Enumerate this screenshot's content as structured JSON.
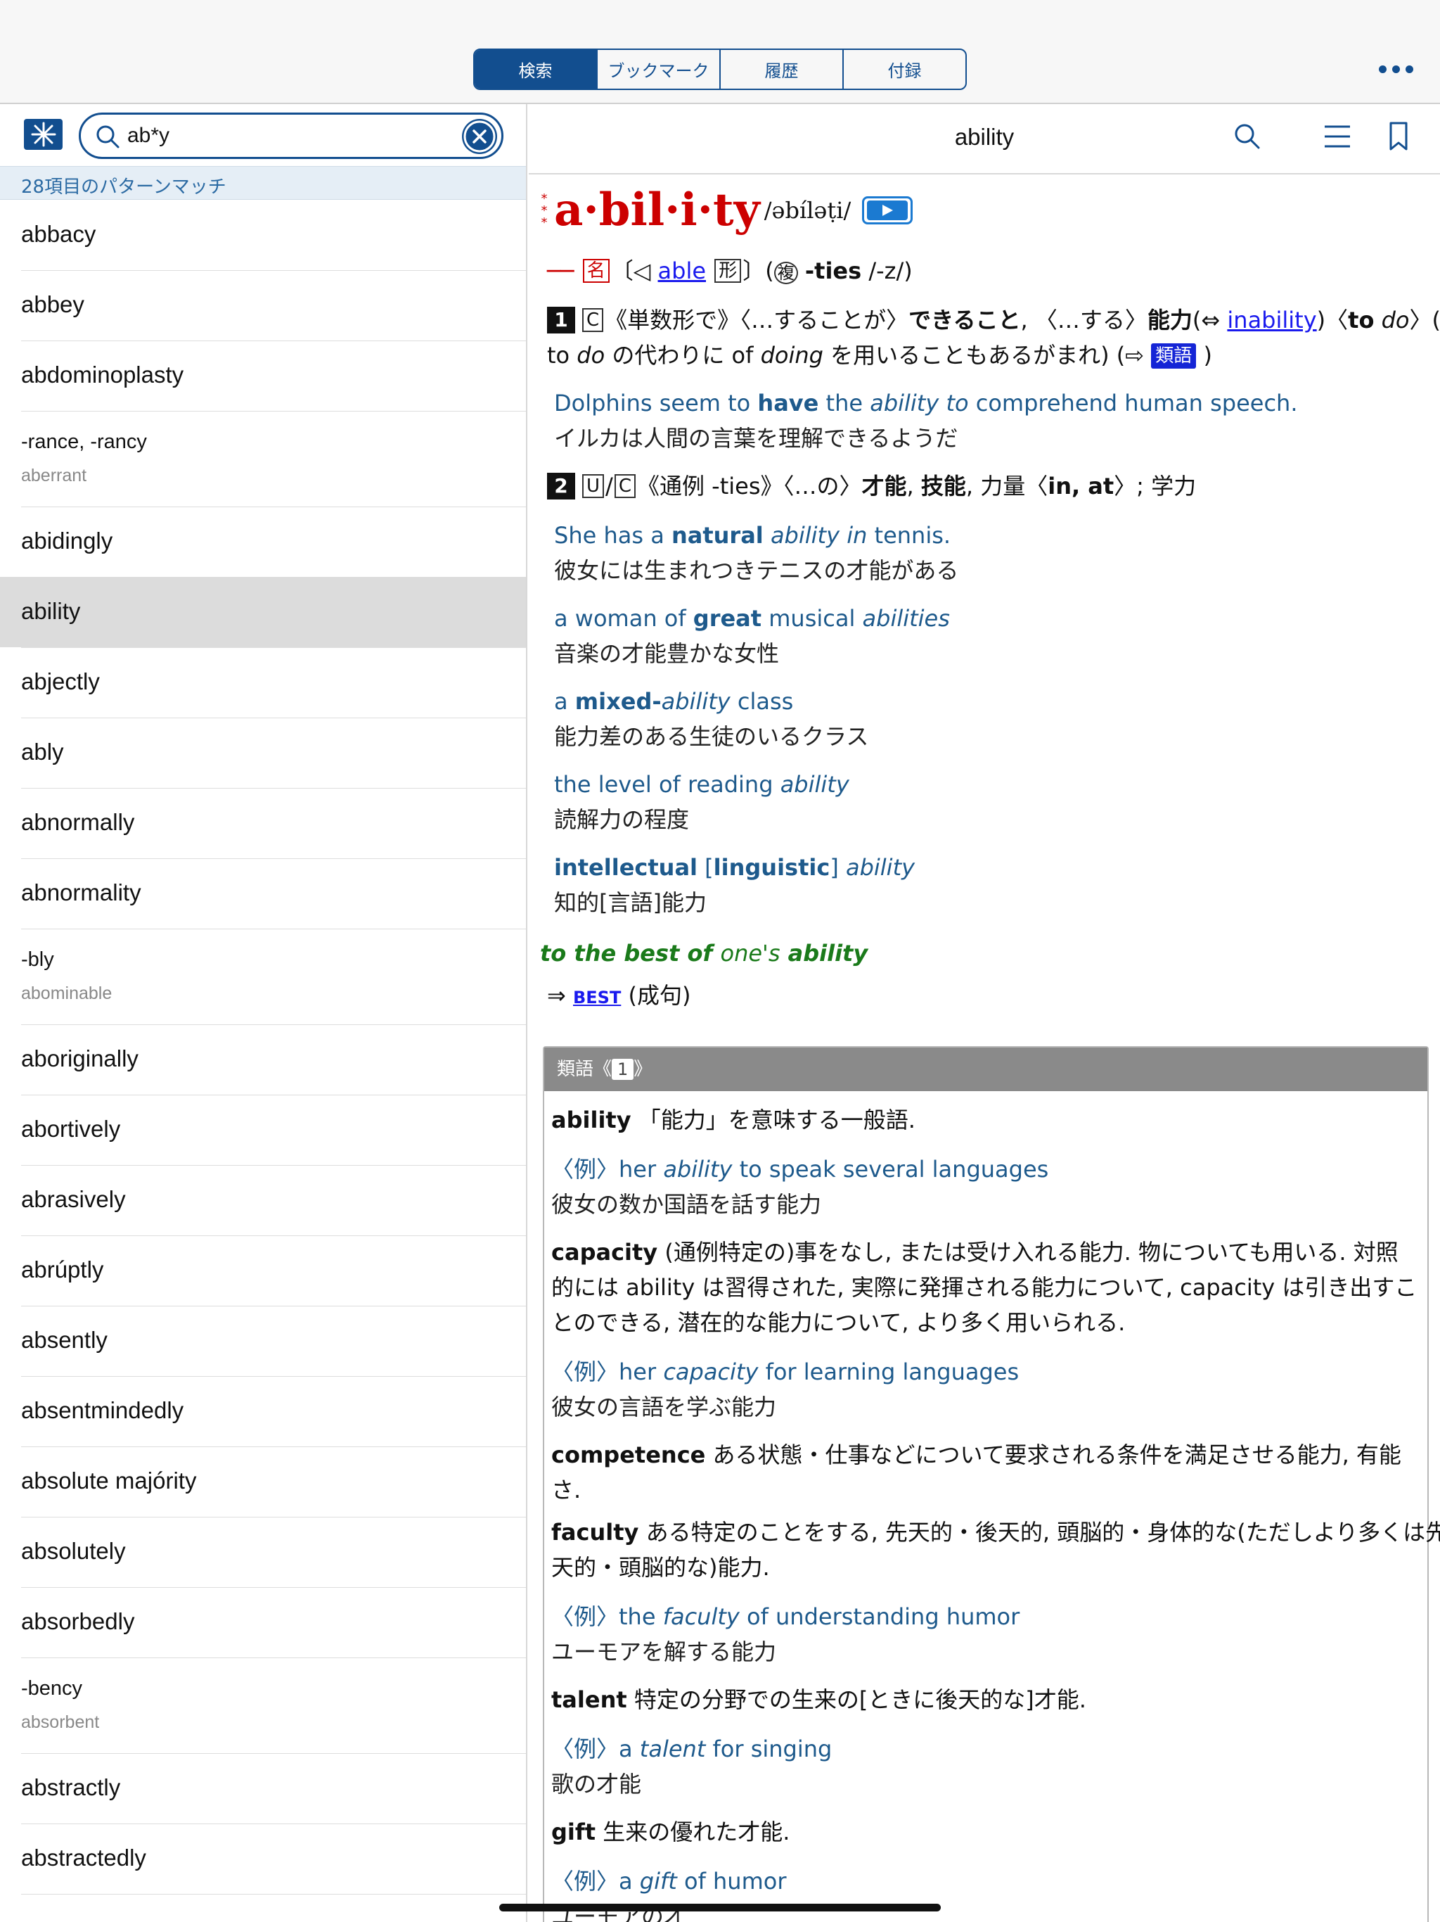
{
  "tabs": [
    "検索",
    "ブックマーク",
    "履歴",
    "付録"
  ],
  "active_tab": 0,
  "search": {
    "value": "ab*y",
    "placeholder": ""
  },
  "match_text": "28項目のパターンマッチ",
  "entries": [
    {
      "word": "abbacy"
    },
    {
      "word": "abbey"
    },
    {
      "word": "abdominoplasty"
    },
    {
      "word": "-rance, -rancy",
      "sub": "aberrant"
    },
    {
      "word": "abidingly"
    },
    {
      "word": "ability",
      "selected": true
    },
    {
      "word": "abjectly"
    },
    {
      "word": "ably"
    },
    {
      "word": "abnormally"
    },
    {
      "word": "abnormality"
    },
    {
      "word": "-bly",
      "sub": "abominable"
    },
    {
      "word": "aboriginally"
    },
    {
      "word": "abortively"
    },
    {
      "word": "abrasively"
    },
    {
      "word": "abrúptly"
    },
    {
      "word": "absently"
    },
    {
      "word": "absentmindedly"
    },
    {
      "word": "absolute majórity"
    },
    {
      "word": "absolutely"
    },
    {
      "word": "absorbedly"
    },
    {
      "word": "-bency",
      "sub": "absorbent"
    },
    {
      "word": "abstractly"
    },
    {
      "word": "abstractedly"
    }
  ],
  "entry": {
    "title": "ability",
    "headword": "a·bil·i·ty",
    "pron": "/əbíləṭi/",
    "pos_line": {
      "dash": "──",
      "pos": "名",
      "open": "〔◁",
      "base": "able",
      "base_pos": "形",
      "close": "〕(",
      "plural_mark": "複",
      "plural": "-ties",
      "plural_pron": "/-z/)"
    },
    "sense1": {
      "num": "1",
      "label": "C",
      "text_a": "《単数形で》〈…することが〉",
      "text_b": "できること",
      "text_c": ", 〈…する〉",
      "text_d": "能力",
      "text_e": "(⇔ ",
      "antonym": "inability",
      "text_f": ")〈",
      "to": "to",
      "do": "do",
      "text_g": "〉(",
      "diamond": "◆",
      "line2_a": "to ",
      "line2_do": "do",
      "line2_b": " の代わりに of ",
      "line2_doing": "doing",
      "line2_c": " を用いることもあるがまれ) (⇨ ",
      "syn_tag": "類語",
      "line2_d": " )"
    },
    "ex1": {
      "en_a": "Dolphins seem to ",
      "en_b": "have",
      "en_c": " the ",
      "en_d": "ability to",
      "en_e": " comprehend human speech.",
      "ja": "イルカは人間の言葉を理解できるようだ"
    },
    "sense2": {
      "num": "2",
      "label_u": "U",
      "slash": "/",
      "label_c": "C",
      "text_a": "《通例 -ties》〈…の〉",
      "t1": "才能",
      "sep": ", ",
      "t2": "技能",
      "text_b": ", 力量〈",
      "in_at": "in, at",
      "text_c": "〉; 学力"
    },
    "ex2": {
      "a": "She has a ",
      "b": "natural",
      "c": " ",
      "d": "ability in",
      "e": " tennis.",
      "ja": "彼女には生まれつきテニスの才能がある"
    },
    "ex3": {
      "a": "a woman of ",
      "b": "great",
      "c": " musical ",
      "d": "abilities",
      "ja": "音楽の才能豊かな女性"
    },
    "ex4": {
      "a": "a ",
      "b": "mixed-",
      "c": "ability",
      "d": " class",
      "ja": "能力差のある生徒のいるクラス"
    },
    "ex5": {
      "a": "the level of reading ",
      "b": "ability",
      "ja": "読解力の程度"
    },
    "ex6": {
      "a": "intellectual",
      "b": " [",
      "c": "linguistic",
      "d": "] ",
      "e": "ability",
      "ja": "知的[言語]能力"
    },
    "idiom": {
      "a": "to the best of ",
      "b": "one's",
      "c": " ability"
    },
    "idiom_ref": {
      "arrow": "⇒ ",
      "link": "BEST",
      "note": " (成句)"
    },
    "synonyms": {
      "header": "類語《",
      "header_num": "1",
      "header_close": "》",
      "s1": {
        "w": "ability",
        "d": " 「能力」を意味する一般語.",
        "ex_a": "〈例〉her ",
        "ex_b": "ability",
        "ex_c": " to speak several languages",
        "ja": "彼女の数か国語を話す能力"
      },
      "s2": {
        "w": "capacity",
        "d1": " (通例特定の)事をなし, または受け入れる能力. 物についても用いる. 対照",
        "d2": "的には ability は習得された, 実際に発揮される能力について, capacity は引き出すこ",
        "d3": "とのできる, 潜在的な能力について, より多く用いられる.",
        "ex_a": "〈例〉her ",
        "ex_b": "capacity",
        "ex_c": " for learning languages",
        "ja": "彼女の言語を学ぶ能力"
      },
      "s3": {
        "w": "competence",
        "d1": " ある状態・仕事などについて要求される条件を満足させる能力, 有能",
        "d2": "さ."
      },
      "s4": {
        "w": "faculty",
        "d1": " ある特定のことをする, 先天的・後天的, 頭脳的・身体的な(ただしより多くは先",
        "d2": "天的・頭脳的な)能力.",
        "ex_a": "〈例〉the ",
        "ex_b": "faculty",
        "ex_c": " of understanding humor",
        "ja": "ユーモアを解する能力"
      },
      "s5": {
        "w": "talent",
        "d": " 特定の分野での生来の[ときに後天的な]才能.",
        "ex_a": "〈例〉a ",
        "ex_b": "talent",
        "ex_c": " for singing",
        "ja": "歌の才能"
      },
      "s6": {
        "w": "gift",
        "d": " 生来の優れた才能.",
        "ex_a": "〈例〉a ",
        "ex_b": "gift",
        "ex_c": " of humor",
        "ja": "ユーモアの才"
      }
    }
  },
  "colors": {
    "accent": "#124e8f",
    "headword": "#cc0000",
    "example": "#1e5a8c",
    "idiom": "#1a7a1a",
    "link": "#1a1aee"
  }
}
